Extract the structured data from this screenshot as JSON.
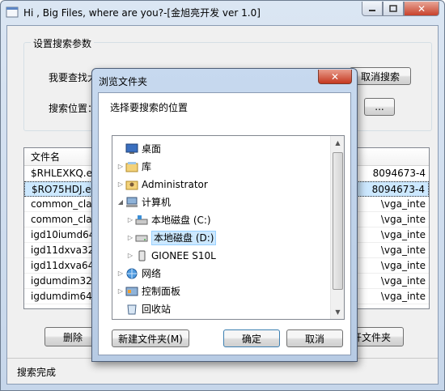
{
  "main_window": {
    "title": "Hi , Big Files, where are you?-[金旭亮开发 ver 1.0]",
    "group_label": "设置搜索参数",
    "find_label": "我要查找大",
    "location_label": "搜索位置：",
    "cancel_search_button": "取消搜索",
    "browse_button": "...",
    "delete_button": "删除",
    "open_folder_button": "开文件夹",
    "status_text": "搜索完成"
  },
  "file_list": {
    "header": "文件名",
    "rows": [
      {
        "name": "$RHLEXKQ.exe",
        "path": "8094673-4"
      },
      {
        "name": "$RO75HDJ.exe",
        "path": "8094673-4"
      },
      {
        "name": "common_clan",
        "path": "\\vga_inte"
      },
      {
        "name": "common_clan",
        "path": "\\vga_inte"
      },
      {
        "name": "igd10iumd64.",
        "path": "\\vga_inte"
      },
      {
        "name": "igd11dxva32.d",
        "path": "\\vga_inte"
      },
      {
        "name": "igd11dxva64.d",
        "path": "\\vga_inte"
      },
      {
        "name": "igdumdim32.d",
        "path": "\\vga_inte"
      },
      {
        "name": "igdumdim64.d",
        "path": "\\vga_inte"
      }
    ]
  },
  "browse_dialog": {
    "title": "浏览文件夹",
    "prompt": "选择要搜索的位置",
    "tree": [
      {
        "label": "桌面",
        "icon": "desktop-icon"
      },
      {
        "label": "库",
        "icon": "library-icon"
      },
      {
        "label": "Administrator",
        "icon": "user-folder-icon"
      },
      {
        "label": "计算机",
        "icon": "computer-icon"
      },
      {
        "label": "本地磁盘 (C:)",
        "icon": "system-drive-icon"
      },
      {
        "label": "本地磁盘 (D:)",
        "icon": "drive-icon"
      },
      {
        "label": "GIONEE S10L",
        "icon": "phone-icon"
      },
      {
        "label": "网络",
        "icon": "network-icon"
      },
      {
        "label": "控制面板",
        "icon": "control-panel-icon"
      },
      {
        "label": "回收站",
        "icon": "recycle-bin-icon"
      }
    ],
    "new_folder_button": "新建文件夹(M)",
    "ok_button": "确定",
    "cancel_button": "取消"
  }
}
